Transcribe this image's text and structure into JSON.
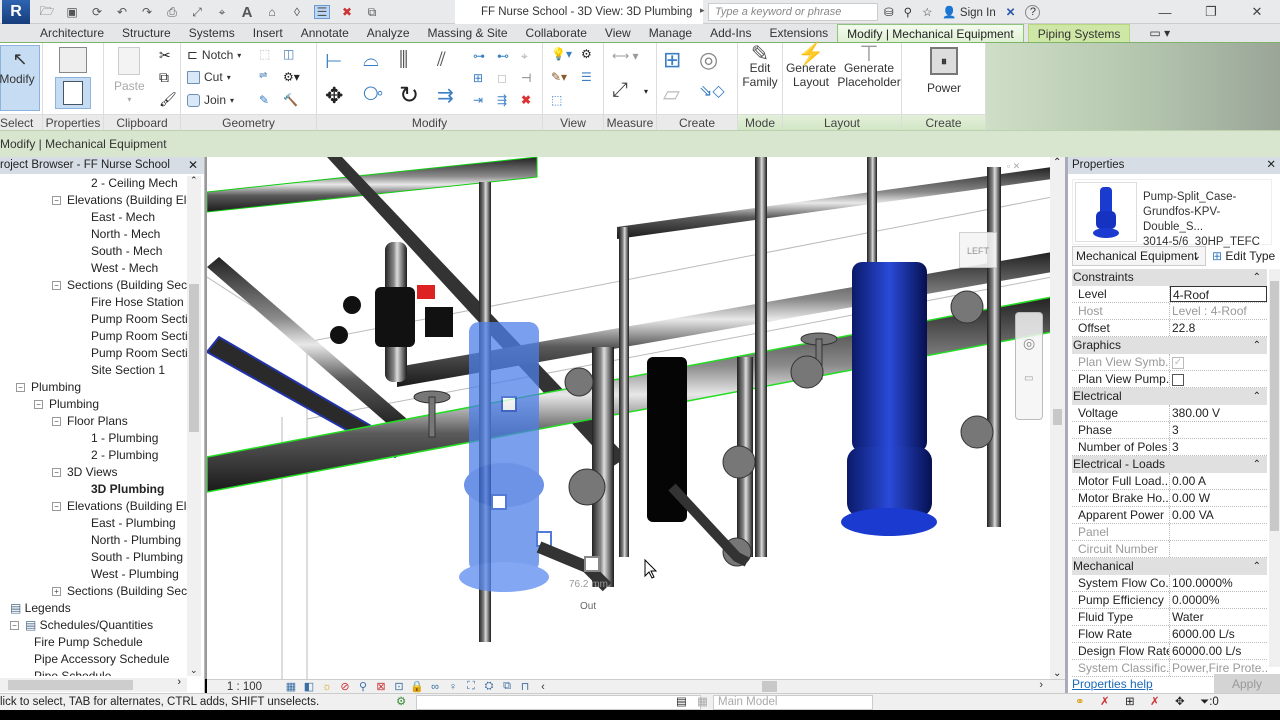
{
  "titlebar": {
    "app_logo": "R",
    "document_title": "FF Nurse School - 3D View: 3D Plumbing",
    "search_placeholder": "Type a keyword or phrase",
    "sign_in": "Sign In",
    "help": "?",
    "window_controls": {
      "minimize": "—",
      "restore": "❐",
      "close": "✕"
    }
  },
  "tabs": [
    {
      "label": "Architecture"
    },
    {
      "label": "Structure"
    },
    {
      "label": "Systems"
    },
    {
      "label": "Insert"
    },
    {
      "label": "Annotate"
    },
    {
      "label": "Analyze"
    },
    {
      "label": "Massing & Site"
    },
    {
      "label": "Collaborate"
    },
    {
      "label": "View"
    },
    {
      "label": "Manage"
    },
    {
      "label": "Add-Ins"
    },
    {
      "label": "Extensions"
    },
    {
      "label": "Modify | Mechanical Equipment",
      "active": true
    },
    {
      "label": "Piping Systems"
    }
  ],
  "ribbon": {
    "select": {
      "button": "Modify",
      "panel": "Select ▾"
    },
    "properties": {
      "panel": "Properties"
    },
    "clipboard": {
      "paste": "Paste",
      "panel": "Clipboard"
    },
    "geometry": {
      "notch": "Notch",
      "cut": "Cut",
      "join": "Join",
      "panel": "Geometry"
    },
    "modify": {
      "panel": "Modify"
    },
    "view": {
      "panel": "View"
    },
    "measure": {
      "panel": "Measure"
    },
    "create": {
      "panel": "Create"
    },
    "mode": {
      "edit_family": "Edit Family",
      "panel": "Mode"
    },
    "layout": {
      "generate_layout": "Generate Layout",
      "generate_placeholder": "Generate Placeholder",
      "panel": "Layout"
    },
    "create_systems": {
      "power": "Power",
      "panel": "Create Systems"
    }
  },
  "option_bar": {
    "text": "Modify | Mechanical Equipment"
  },
  "project_browser": {
    "title": "roject Browser - FF Nurse School",
    "items": [
      {
        "label": "2 - Ceiling Mech",
        "level": 4
      },
      {
        "label": "Elevations (Building Ele",
        "level": 3,
        "expander": "−"
      },
      {
        "label": "East - Mech",
        "level": 4
      },
      {
        "label": "North - Mech",
        "level": 4
      },
      {
        "label": "South - Mech",
        "level": 4
      },
      {
        "label": "West - Mech",
        "level": 4
      },
      {
        "label": "Sections (Building Sect",
        "level": 3,
        "expander": "−"
      },
      {
        "label": "Fire Hose Station S",
        "level": 4
      },
      {
        "label": "Pump Room Sectio",
        "level": 4
      },
      {
        "label": "Pump Room Sectio",
        "level": 4
      },
      {
        "label": "Pump Room Sectio",
        "level": 4
      },
      {
        "label": "Site Section 1",
        "level": 4
      },
      {
        "label": "Plumbing",
        "level": 1,
        "expander": "−"
      },
      {
        "label": "Plumbing",
        "level": 2,
        "expander": "−"
      },
      {
        "label": "Floor Plans",
        "level": 3,
        "expander": "−"
      },
      {
        "label": "1 - Plumbing",
        "level": 4
      },
      {
        "label": "2 - Plumbing",
        "level": 4
      },
      {
        "label": "3D Views",
        "level": 3,
        "expander": "−"
      },
      {
        "label": "3D Plumbing",
        "level": 4,
        "bold": true
      },
      {
        "label": "Elevations (Building Ele",
        "level": 3,
        "expander": "−"
      },
      {
        "label": "East - Plumbing",
        "level": 4
      },
      {
        "label": "North - Plumbing",
        "level": 4
      },
      {
        "label": "South - Plumbing",
        "level": 4
      },
      {
        "label": "West - Plumbing",
        "level": 4
      },
      {
        "label": "Sections (Building Sect",
        "level": 3,
        "expander": "+"
      },
      {
        "label": "Legends",
        "level": 0,
        "icon": "legend-icon"
      },
      {
        "label": "Schedules/Quantities",
        "level": 0,
        "expander": "−",
        "icon": "schedule-icon"
      },
      {
        "label": "Fire Pump Schedule",
        "level": 1.5
      },
      {
        "label": "Pipe Accessory Schedule",
        "level": 1.5
      },
      {
        "label": "Pipe Schedule",
        "level": 1.5
      }
    ]
  },
  "viewport": {
    "viewcube_face": "LEFT",
    "annotations": [
      "Out",
      "76.2 mm"
    ],
    "scale": "1 : 100"
  },
  "properties": {
    "title": "Properties",
    "type_name": [
      "Pump-Split_Case-",
      "Grundfos-KPV-Double_S...",
      "3014-5/6_30HP_TEFC"
    ],
    "category": "Mechanical Equipment",
    "edit_type": "Edit Type",
    "sections": [
      {
        "name": "Constraints",
        "rows": [
          {
            "key": "Level",
            "value": "4-Roof",
            "editing": true
          },
          {
            "key": "Host",
            "value": "Level : 4-Roof",
            "dim": true
          },
          {
            "key": "Offset",
            "value": "22.8"
          }
        ]
      },
      {
        "name": "Graphics",
        "rows": [
          {
            "key": "Plan View Symb...",
            "checkbox": true,
            "checked": true,
            "dim": true
          },
          {
            "key": "Plan View Pump...",
            "checkbox": true,
            "checked": false
          }
        ]
      },
      {
        "name": "Electrical",
        "rows": [
          {
            "key": "Voltage",
            "value": "380.00 V"
          },
          {
            "key": "Phase",
            "value": "3"
          },
          {
            "key": "Number of Poles",
            "value": "3"
          }
        ]
      },
      {
        "name": "Electrical - Loads",
        "rows": [
          {
            "key": "Motor Full Load...",
            "value": "0.00 A"
          },
          {
            "key": "Motor Brake Ho...",
            "value": "0.00 W"
          },
          {
            "key": "Apparent Power",
            "value": "0.00 VA"
          },
          {
            "key": "Panel",
            "value": "",
            "dim": true
          },
          {
            "key": "Circuit Number",
            "value": "",
            "dim": true
          }
        ]
      },
      {
        "name": "Mechanical",
        "rows": [
          {
            "key": "System Flow Co...",
            "value": "100.0000%"
          },
          {
            "key": "Pump Efficiency",
            "value": "0.0000%"
          },
          {
            "key": "Fluid Type",
            "value": "Water"
          },
          {
            "key": "Flow Rate",
            "value": "6000.00 L/s"
          },
          {
            "key": "Design Flow Rate",
            "value": "60000.00 L/s"
          },
          {
            "key": "System Classific...",
            "value": "Power,Fire Prote...",
            "dim": true
          }
        ]
      }
    ],
    "help_link": "Properties help",
    "apply": "Apply"
  },
  "status_bar": {
    "text": "lick to select, TAB for alternates, CTRL adds, SHIFT unselects.",
    "model": "Main Model",
    "filter_count": ":0"
  },
  "colors": {
    "accent_green": "#8fc57a",
    "selection_blue": "#3a6fd8",
    "link_blue": "#1d6ab8"
  }
}
